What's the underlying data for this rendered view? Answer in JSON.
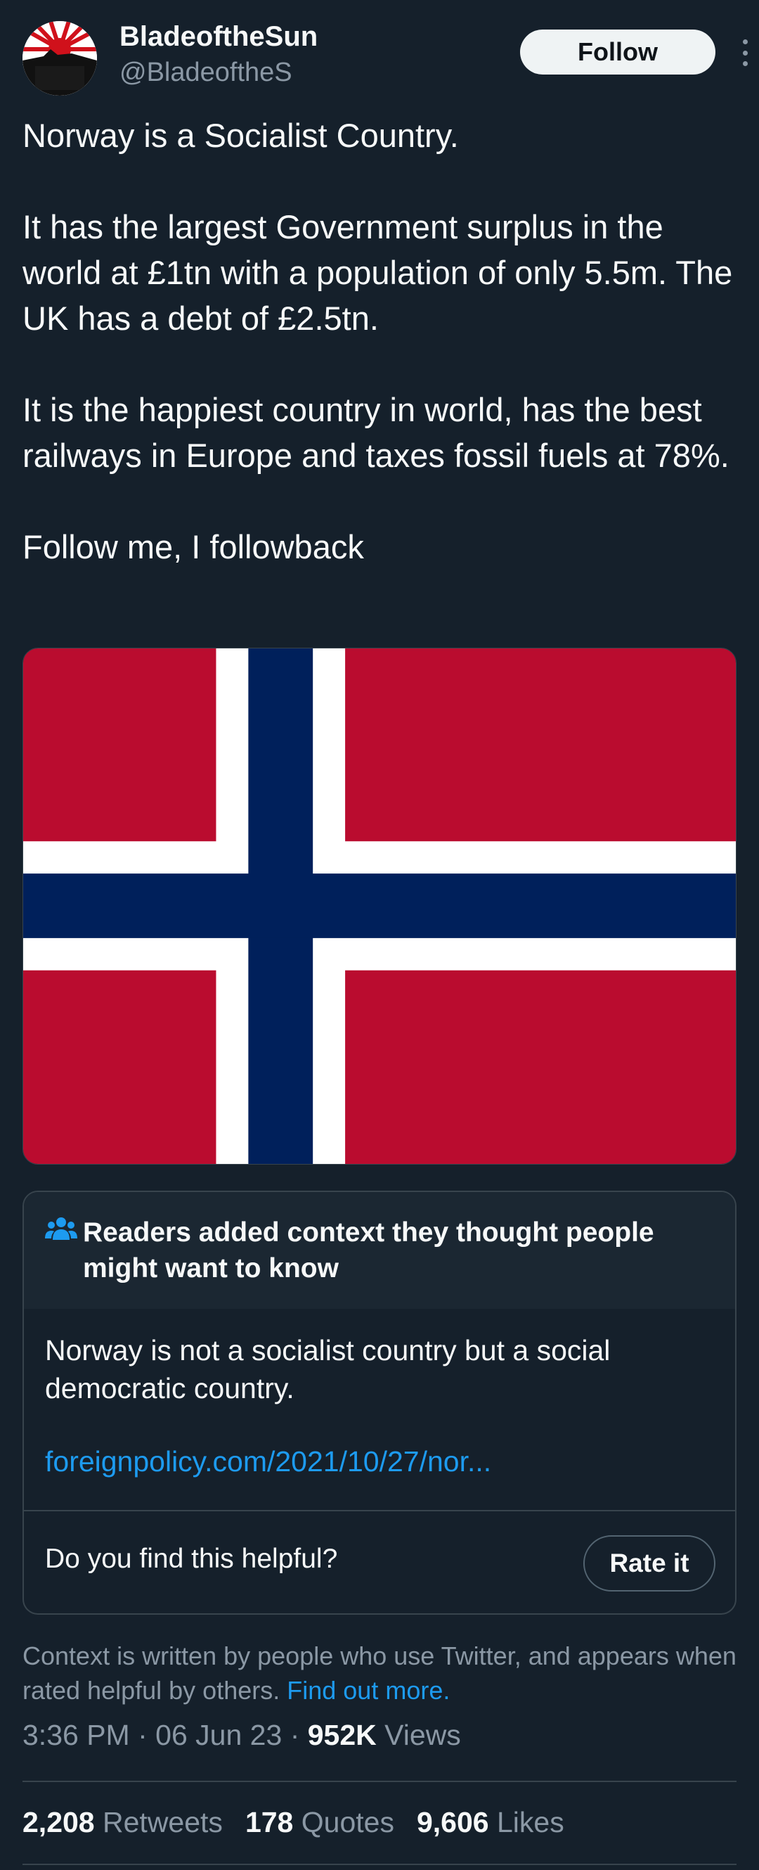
{
  "author": {
    "display_name": "BladeoftheSun",
    "handle": "@BladeoftheS",
    "avatar_icon": "rising-sun-avatar"
  },
  "header": {
    "follow_label": "Follow",
    "more_icon": "more-vertical-icon"
  },
  "tweet": {
    "paragraphs": [
      "Norway is a Socialist Country.",
      "It has the largest Government surplus in the world at £1tn with a population of only 5.5m. The UK has a debt of £2.5tn.",
      "It is the happiest country in world, has the best railways in Europe and taxes fossil fuels at 78%.",
      "Follow me, I followback"
    ],
    "media": {
      "subject": "norway-flag",
      "colors": {
        "red": "#ba0c2f",
        "white": "#ffffff",
        "blue": "#00205b"
      }
    }
  },
  "community_note": {
    "icon": "people-icon",
    "title": "Readers added context they thought people might want to know",
    "text": "Norway is not a socialist country but a social democratic country.",
    "link": "foreignpolicy.com/2021/10/27/nor...",
    "helpful_question": "Do you find this helpful?",
    "rate_label": "Rate it"
  },
  "disclaimer": {
    "text": "Context is written by people who use Twitter, and appears when rated helpful by others.",
    "link": "Find out more."
  },
  "meta": {
    "time": "3:36 PM",
    "separator": "·",
    "date": "06 Jun 23",
    "views_count": "952K",
    "views_label": "Views"
  },
  "stats": {
    "retweets_count": "2,208",
    "retweets_label": "Retweets",
    "quotes_count": "178",
    "quotes_label": "Quotes",
    "likes_count": "9,606",
    "likes_label": "Likes"
  },
  "colors": {
    "background": "#15202b",
    "accent": "#1d9bf0",
    "muted_text": "#8b98a5",
    "border": "#38444d"
  }
}
